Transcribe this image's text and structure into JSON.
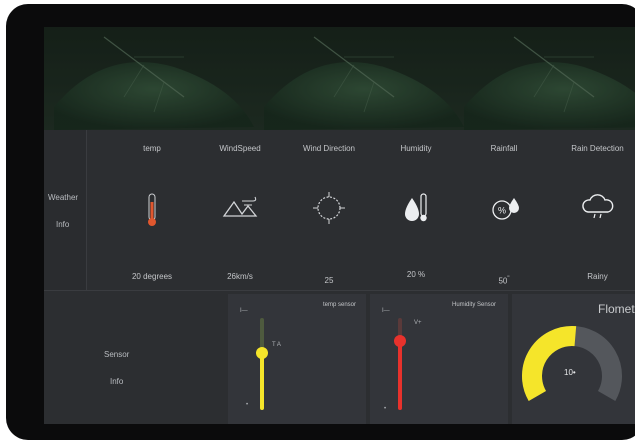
{
  "weather_info": {
    "label_line1": "Weather",
    "label_line2": "Info",
    "columns": [
      {
        "title": "temp",
        "value": "20 degrees",
        "icon": "thermometer-icon"
      },
      {
        "title": "WindSpeed",
        "value": "26km/s",
        "icon": "wind-mountain-icon"
      },
      {
        "title": "Wind Direction",
        "value": "25",
        "icon": "compass-icon"
      },
      {
        "title": "Humidity",
        "value": "20 %",
        "icon": "humidity-icon"
      },
      {
        "title": "Rainfall",
        "value": "50",
        "value_suffix": "\"",
        "icon": "rainfall-icon"
      },
      {
        "title": "Rain Detection",
        "value": "Rainy",
        "icon": "rain-cloud-icon"
      }
    ]
  },
  "sensor_info": {
    "label_line1": "Sensor",
    "label_line2": "Info",
    "temp_sensor": {
      "title": "temp sensor",
      "top_mark": "I—",
      "side_label": "T A",
      "bottom_mark": "•",
      "level": 0.62,
      "color": "#f5e52a"
    },
    "humidity_sensor": {
      "title": "Humidity Sensor",
      "top_mark": "I—",
      "side_label": "V+",
      "bottom_mark": "•",
      "level": 0.75,
      "color": "#e8322c"
    },
    "flowmeter": {
      "title": "Flomet",
      "value": "10",
      "value_suffix": "•",
      "level": 0.52,
      "fill_color": "#f5e52a",
      "track_color": "#54575c"
    }
  }
}
